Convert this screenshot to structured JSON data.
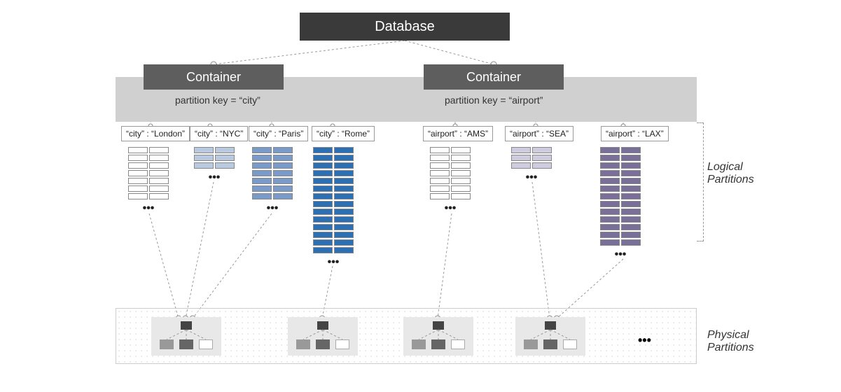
{
  "root": {
    "label": "Database"
  },
  "containers": {
    "left": {
      "label": "Container",
      "partition_key_text": "partition key = “city”",
      "partitions": [
        {
          "label": "“city” : “London”",
          "rows": 7,
          "color": "white"
        },
        {
          "label": "“city” : “NYC”",
          "rows": 3,
          "color": "lblue"
        },
        {
          "label": "“city” : “Paris”",
          "rows": 7,
          "color": "mblue"
        },
        {
          "label": "“city” : “Rome”",
          "rows": 14,
          "color": "blue"
        }
      ]
    },
    "right": {
      "label": "Container",
      "partition_key_text": "partition key = “airport”",
      "partitions": [
        {
          "label": "“airport” : “AMS”",
          "rows": 7,
          "color": "white"
        },
        {
          "label": "“airport” : “SEA”",
          "rows": 3,
          "color": "lpurp"
        },
        {
          "label": "“airport” : “LAX”",
          "rows": 13,
          "color": "purp"
        }
      ]
    }
  },
  "side_labels": {
    "logical": "Logical\nPartitions",
    "physical": "Physical\nPartitions"
  },
  "physical": {
    "server_count": 4,
    "ellipsis": "•••"
  },
  "ellipsis": "•••"
}
